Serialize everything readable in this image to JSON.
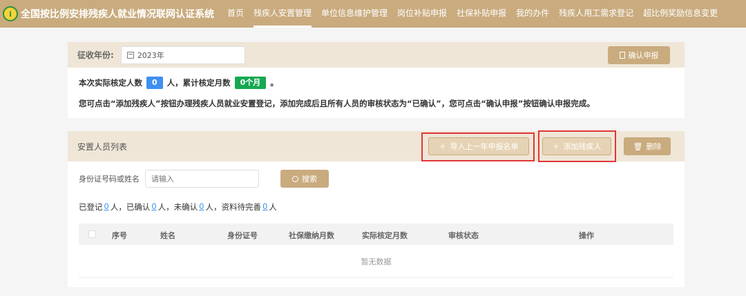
{
  "app": {
    "title": "全国按比例安排残疾人就业情况联网认证系统",
    "logo_text": "i"
  },
  "nav": {
    "items": [
      {
        "label": "首页",
        "active": false
      },
      {
        "label": "残疾人安置管理",
        "active": true
      },
      {
        "label": "单位信息维护管理",
        "active": false
      },
      {
        "label": "岗位补贴申报",
        "active": false
      },
      {
        "label": "社保补贴申报",
        "active": false
      },
      {
        "label": "我的办件",
        "active": false
      },
      {
        "label": "残疾人用工需求登记",
        "active": false
      },
      {
        "label": "超比例奖励信息变更",
        "active": false
      }
    ]
  },
  "declaration": {
    "year_label": "征收年份:",
    "year_value": "2023年",
    "confirm_button": "确认申报",
    "summary_prefix": "本次实际核定人数",
    "people_count": "0",
    "summary_mid": "人，累计核定月数",
    "months_value": "0个月",
    "summary_suffix": "。",
    "instruction": "您可点击“添加残疾人”按钮办理残疾人员就业安置登记，添加完成后且所有人员的审核状态为“已确认”，您可点击“确认申报”按钮确认申报完成。"
  },
  "list": {
    "title": "安置人员列表",
    "import_button": "导入上一年申报名单",
    "add_button": "添加残疾人",
    "delete_button": "删除",
    "search_label": "身份证号码或姓名",
    "search_placeholder": "请输入",
    "search_button": "搜索",
    "counts": {
      "registered_label": "已登记",
      "registered": "0",
      "confirmed_label": "人，已确认",
      "confirmed": "0",
      "unconfirmed_label": "人，未确认",
      "unconfirmed": "0",
      "pending_label": "人，资料待完善",
      "pending": "0",
      "unit": "人"
    },
    "columns": [
      "序号",
      "姓名",
      "身份证号",
      "社保缴纳月数",
      "实际核定月数",
      "审核状态",
      "操作"
    ],
    "empty_text": "暂无数据"
  },
  "colors": {
    "brand": "#c9ab7e",
    "highlight": "#e03636",
    "blue_tag": "#3f8ff0",
    "green_tag": "#17a851"
  }
}
